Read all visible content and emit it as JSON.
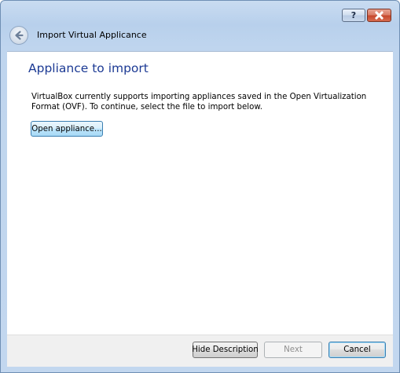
{
  "window": {
    "title": "Import Virtual Applicance",
    "help_label": "?"
  },
  "page": {
    "heading": "Appliance to import",
    "description": "VirtualBox currently supports importing appliances saved in the Open Virtualization Format (OVF). To continue, select the file to import below.",
    "open_button_label": "Open appliance..."
  },
  "footer": {
    "hide_description_label": "Hide Description",
    "next_label": "Next",
    "cancel_label": "Cancel"
  },
  "icons": {
    "back": "back-arrow-icon",
    "help": "help-icon",
    "close": "close-icon"
  },
  "colors": {
    "heading": "#1c3a94",
    "close_button": "#c5462a",
    "frame": "#bfd5ee"
  }
}
